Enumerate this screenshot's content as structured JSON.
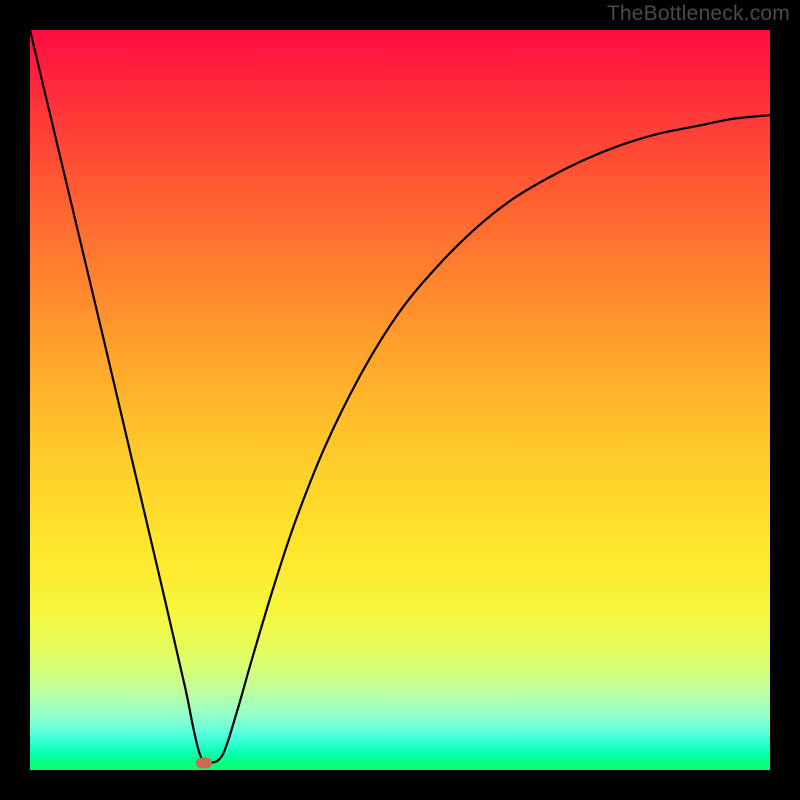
{
  "watermark": "TheBottleneck.com",
  "chart_data": {
    "type": "line",
    "title": "",
    "xlabel": "",
    "ylabel": "",
    "xlim": [
      0,
      100
    ],
    "ylim": [
      0,
      100
    ],
    "series": [
      {
        "name": "bottleneck-curve",
        "x": [
          0,
          5,
          10,
          14,
          18,
          21,
          22,
          23,
          24,
          26,
          28,
          30,
          33,
          36,
          40,
          45,
          50,
          55,
          60,
          65,
          70,
          75,
          80,
          85,
          90,
          95,
          100
        ],
        "values": [
          100,
          79,
          58,
          41,
          24,
          11,
          6,
          2,
          1,
          2,
          8,
          15,
          25,
          34,
          44,
          54,
          62,
          68,
          73,
          77,
          80,
          82.5,
          84.5,
          86,
          87,
          88,
          88.5
        ]
      }
    ],
    "marker": {
      "x": 23.5,
      "y": 1,
      "name": "optimal-point"
    },
    "background_gradient": {
      "top": "#ff0d41",
      "mid": "#ffd12b",
      "bottom": "#0eff6e"
    },
    "colors": {
      "curve": "#000000",
      "marker": "#c96a52",
      "frame": "#000000",
      "watermark": "#4a4a4a"
    }
  }
}
